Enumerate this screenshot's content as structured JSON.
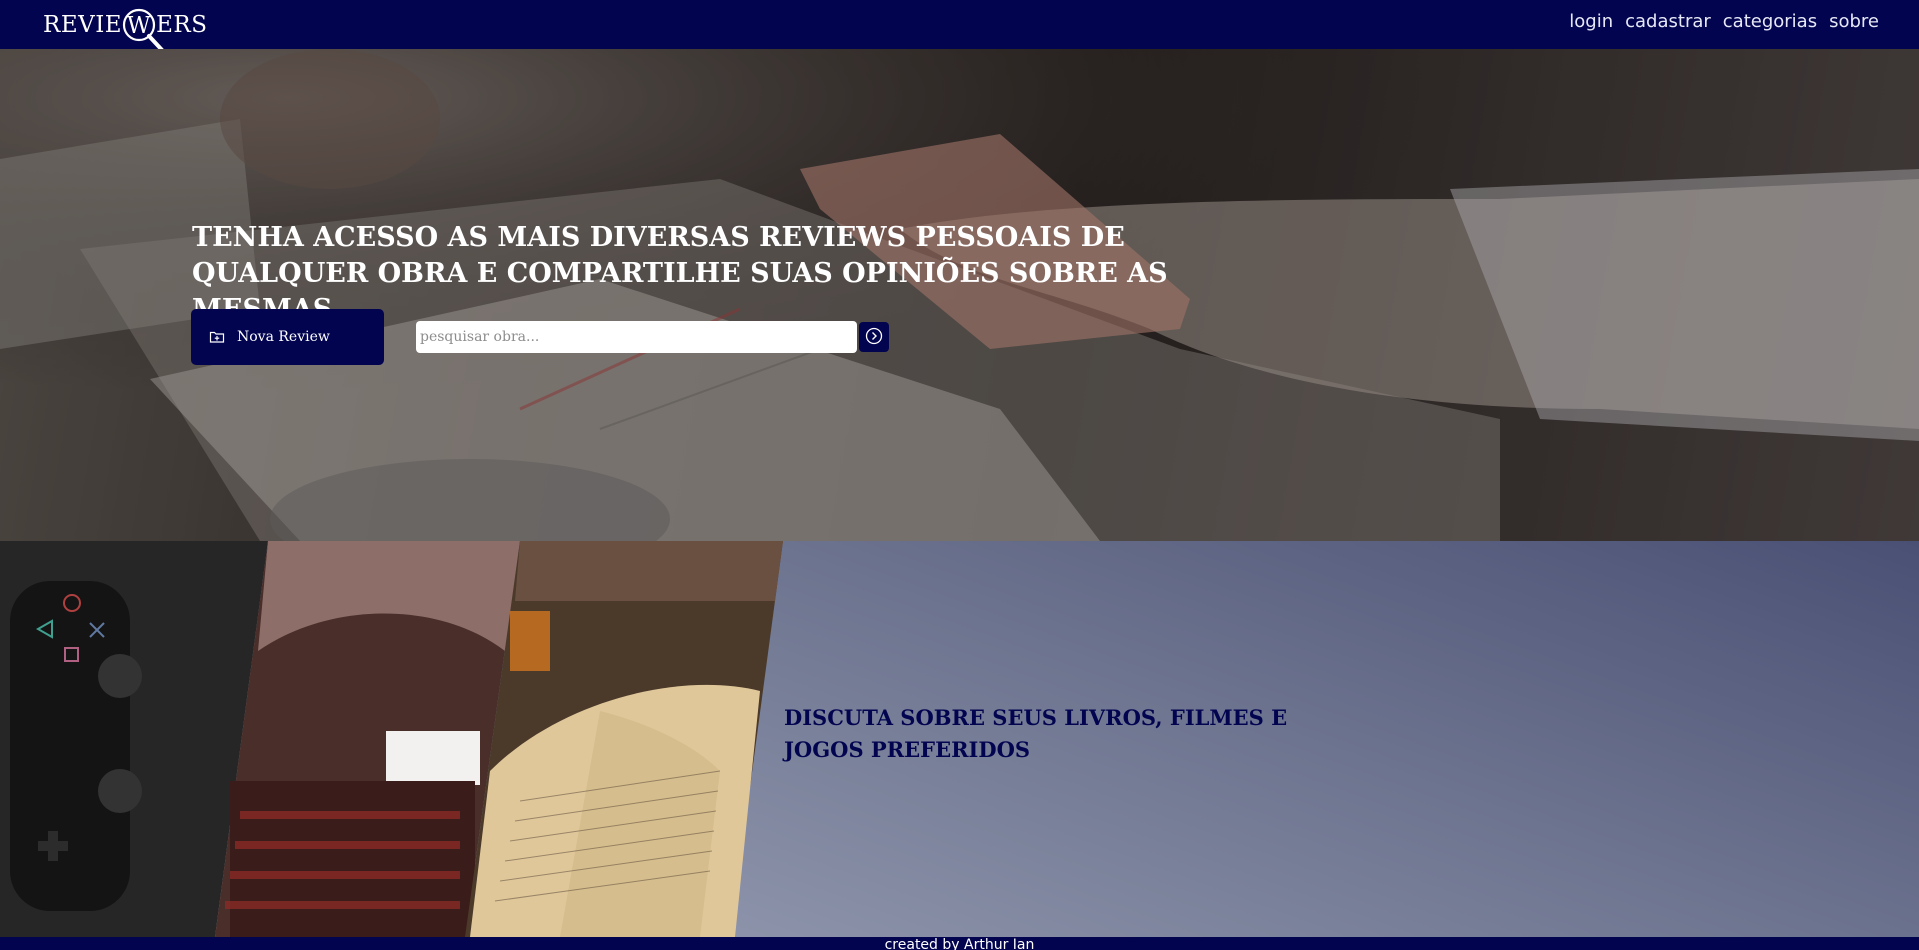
{
  "header": {
    "logo_text_left": "REVIE",
    "logo_mark_letter": "W",
    "logo_text_right": "ERS",
    "nav": [
      "login",
      "cadastrar",
      "categorias",
      "sobre"
    ]
  },
  "hero": {
    "heading": "TENHA ACESSO AS MAIS DIVERSAS REVIEWS PESSOAIS DE QUALQUER OBRA E COMPARTILHE SUAS OPINIÕES SOBRE AS MESMAS",
    "new_review_label": "Nova Review",
    "search": {
      "placeholder": "pesquisar obra...",
      "value": ""
    }
  },
  "section2": {
    "heading": "DISCUTA SOBRE SEUS LIVROS, FILMES E JOGOS PREFERIDOS"
  },
  "footer": {
    "text": "created by Arthur Ian"
  },
  "colors": {
    "primary": "#020450",
    "text_light": "#ffffff",
    "section_grad_dark": "#4a5074",
    "section_grad_light": "#a0a7bb"
  },
  "icons": [
    "magnifier-logo-icon",
    "folder-plus-icon",
    "arrow-right-circle-icon"
  ]
}
